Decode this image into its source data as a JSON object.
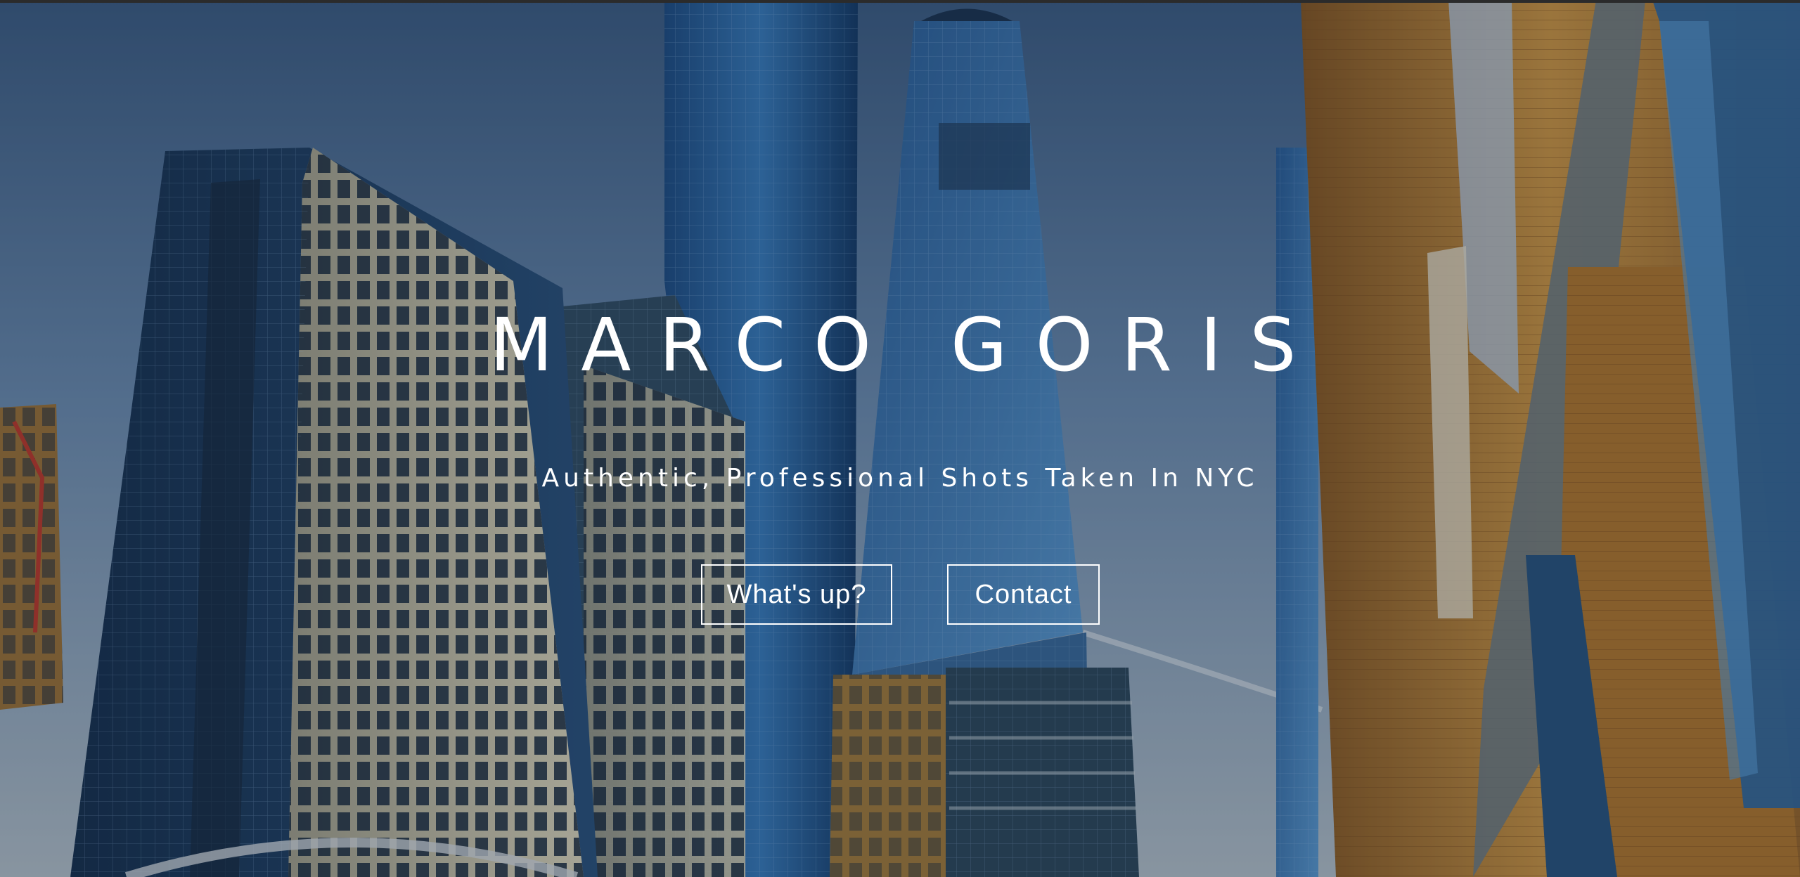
{
  "hero": {
    "title": "MARCO GORIS",
    "subtitle": "Authentic, Professional Shots Taken In NYC",
    "background_image": "nyc-skyline-photo"
  },
  "buttons": {
    "whats_up_label": "What's up?",
    "contact_label": "Contact"
  },
  "colors": {
    "text": "#ffffff",
    "overlay": "#0a1628",
    "sky": "#6f8fb4",
    "glass_tower": "#2f6fa8",
    "brick": "#c8913a"
  }
}
